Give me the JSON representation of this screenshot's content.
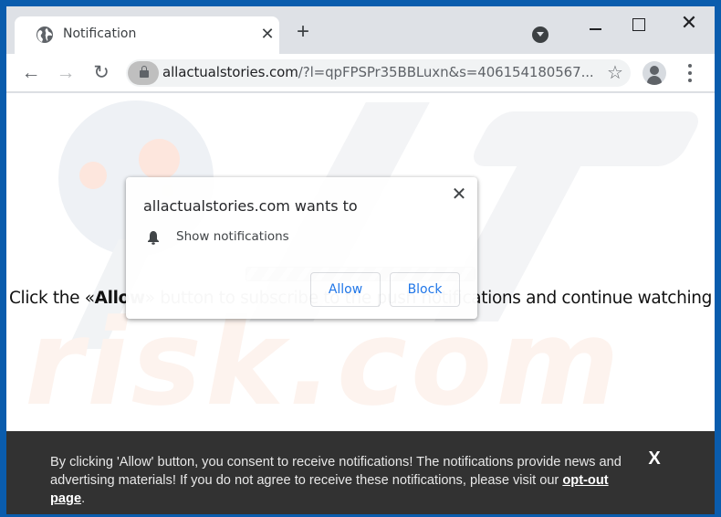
{
  "browser": {
    "tab": {
      "title": "Notification",
      "favicon": "globe-icon",
      "close_glyph": "✕"
    },
    "new_tab_glyph": "+",
    "window_controls": {
      "minimize": "minimize-icon",
      "maximize": "maximize-icon",
      "close_glyph": "✕"
    },
    "nav": {
      "back_glyph": "←",
      "forward_glyph": "→",
      "reload_glyph": "↻"
    },
    "address_bar": {
      "domain": "allactualstories.com",
      "path": "/?l=qpFPSPr35BBLuxn&s=406154180567...",
      "lock": "lock-icon",
      "star_glyph": "☆"
    }
  },
  "permission_prompt": {
    "title": "allactualstories.com wants to",
    "permission": "Show notifications",
    "close_glyph": "✕",
    "allow_label": "Allow",
    "block_label": "Block"
  },
  "page": {
    "cta_prefix": "Click the «",
    "cta_bold": "Allow",
    "cta_suffix": "» button to subscribe to the push notifications and continue watching",
    "watermark_text": "risk.com"
  },
  "banner": {
    "text": "By clicking 'Allow' button, you consent to receive notifications! The notifications provide news and advertising materials! If you do not agree to receive these notifications, please visit our ",
    "link_label": "opt-out page",
    "suffix": ".",
    "close_glyph": "X"
  },
  "colors": {
    "frame": "#0a5cad",
    "accent": "#1a73e8",
    "banner_bg": "#323232"
  }
}
